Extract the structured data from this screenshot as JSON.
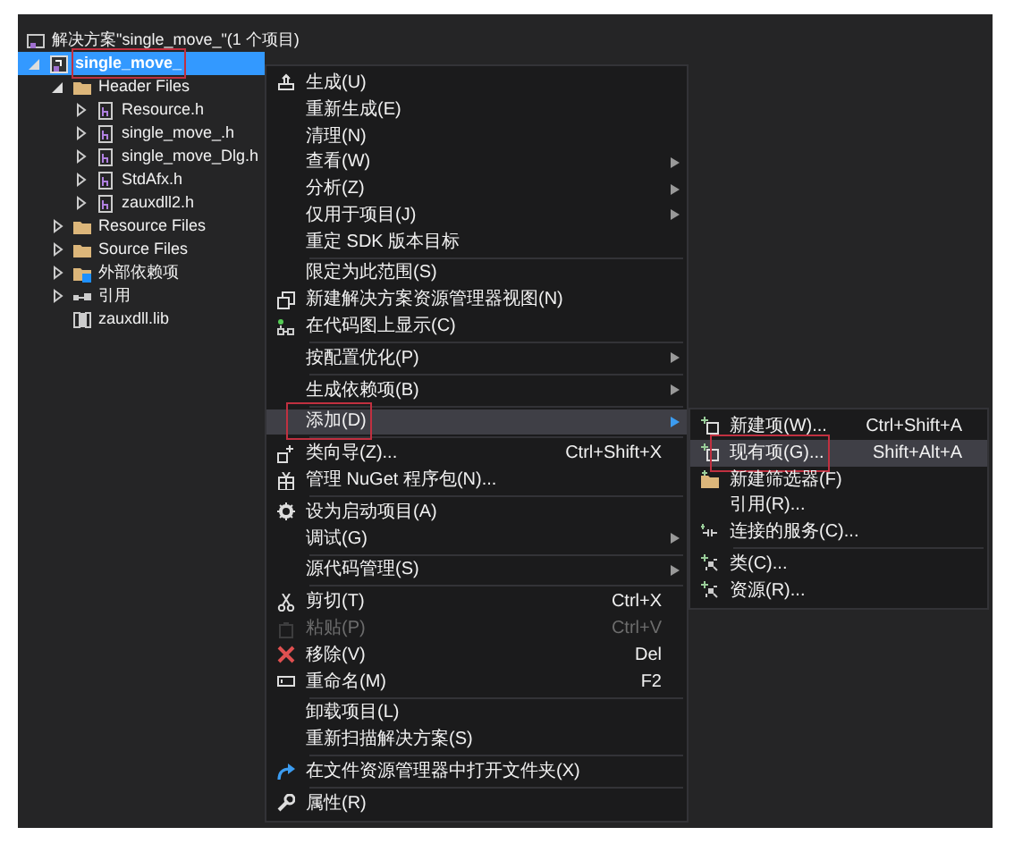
{
  "tree": [
    {
      "label": "解决方案\"single_move_\"(1 个项目)",
      "kind": "solution",
      "selected": false
    },
    {
      "label": "single_move_",
      "kind": "project",
      "selected": true,
      "expanded": true,
      "children": [
        {
          "label": "Header Files",
          "kind": "folder",
          "selected": false,
          "expanded": true,
          "children": [
            {
              "label": "Resource.h",
              "kind": "header",
              "selected": false,
              "expanded": false
            },
            {
              "label": "single_move_.h",
              "kind": "header",
              "selected": false,
              "expanded": false
            },
            {
              "label": "single_move_Dlg.h",
              "kind": "header",
              "selected": false,
              "expanded": false
            },
            {
              "label": "StdAfx.h",
              "kind": "header",
              "selected": false,
              "expanded": false
            },
            {
              "label": "zauxdll2.h",
              "kind": "header",
              "selected": false,
              "expanded": false
            }
          ]
        },
        {
          "label": "Resource Files",
          "kind": "folder",
          "selected": false,
          "expanded": false
        },
        {
          "label": "Source Files",
          "kind": "folder",
          "selected": false,
          "expanded": false
        },
        {
          "label": "外部依赖项",
          "kind": "external",
          "selected": false,
          "expanded": false
        },
        {
          "label": "引用",
          "kind": "references",
          "selected": false,
          "expanded": false
        },
        {
          "label": "zauxdll.lib",
          "kind": "library",
          "selected": false
        }
      ]
    }
  ],
  "context_menu": [
    {
      "kind": "build",
      "label": "生成(U)",
      "selected": false,
      "disabled": false,
      "submenu": false
    },
    {
      "kind": "plain",
      "label": "重新生成(E)",
      "selected": false,
      "disabled": false,
      "submenu": false
    },
    {
      "kind": "plain",
      "label": "清理(N)",
      "selected": false,
      "disabled": false,
      "submenu": false
    },
    {
      "kind": "plain",
      "label": "查看(W)",
      "selected": false,
      "disabled": false,
      "submenu": true
    },
    {
      "kind": "plain",
      "label": "分析(Z)",
      "selected": false,
      "disabled": false,
      "submenu": true
    },
    {
      "kind": "plain",
      "label": "仅用于项目(J)",
      "selected": false,
      "disabled": false,
      "submenu": true
    },
    {
      "kind": "plain",
      "label": "重定 SDK 版本目标",
      "selected": false,
      "disabled": false,
      "submenu": false
    },
    {
      "kind": "separator"
    },
    {
      "kind": "plain",
      "label": "限定为此范围(S)",
      "selected": false,
      "disabled": false,
      "submenu": false
    },
    {
      "kind": "new-view",
      "label": "新建解决方案资源管理器视图(N)",
      "selected": false,
      "disabled": false,
      "submenu": false
    },
    {
      "kind": "code-map",
      "label": "在代码图上显示(C)",
      "selected": false,
      "disabled": false,
      "submenu": false
    },
    {
      "kind": "separator"
    },
    {
      "kind": "plain",
      "label": "按配置优化(P)",
      "selected": false,
      "disabled": false,
      "submenu": true
    },
    {
      "kind": "separator"
    },
    {
      "kind": "plain",
      "label": "生成依赖项(B)",
      "selected": false,
      "disabled": false,
      "submenu": true
    },
    {
      "kind": "separator"
    },
    {
      "kind": "plain",
      "label": "添加(D)",
      "selected": true,
      "disabled": false,
      "submenu": true
    },
    {
      "kind": "separator"
    },
    {
      "kind": "wizard",
      "label": "类向导(Z)...",
      "shortcut": "Ctrl+Shift+X",
      "selected": false,
      "disabled": false,
      "submenu": false
    },
    {
      "kind": "package",
      "label": "管理 NuGet 程序包(N)...",
      "selected": false,
      "disabled": false,
      "submenu": false
    },
    {
      "kind": "separator"
    },
    {
      "kind": "gear",
      "label": "设为启动项目(A)",
      "selected": false,
      "disabled": false,
      "submenu": false
    },
    {
      "kind": "plain",
      "label": "调试(G)",
      "selected": false,
      "disabled": false,
      "submenu": true
    },
    {
      "kind": "separator"
    },
    {
      "kind": "plain",
      "label": "源代码管理(S)",
      "selected": false,
      "disabled": false,
      "submenu": true
    },
    {
      "kind": "separator"
    },
    {
      "kind": "cut",
      "label": "剪切(T)",
      "shortcut": "Ctrl+X",
      "selected": false,
      "disabled": false,
      "submenu": false
    },
    {
      "kind": "paste",
      "label": "粘贴(P)",
      "shortcut": "Ctrl+V",
      "selected": false,
      "disabled": true,
      "submenu": false
    },
    {
      "kind": "remove",
      "label": "移除(V)",
      "shortcut": "Del",
      "selected": false,
      "disabled": false,
      "submenu": false
    },
    {
      "kind": "rename",
      "label": "重命名(M)",
      "shortcut": "F2",
      "selected": false,
      "disabled": false,
      "submenu": false
    },
    {
      "kind": "separator"
    },
    {
      "kind": "plain",
      "label": "卸载项目(L)",
      "selected": false,
      "disabled": false,
      "submenu": false
    },
    {
      "kind": "plain",
      "label": "重新扫描解决方案(S)",
      "selected": false,
      "disabled": false,
      "submenu": false
    },
    {
      "kind": "separator"
    },
    {
      "kind": "open-folder",
      "label": "在文件资源管理器中打开文件夹(X)",
      "selected": false,
      "disabled": false,
      "submenu": false
    },
    {
      "kind": "separator"
    },
    {
      "kind": "wrench",
      "label": "属性(R)",
      "selected": false,
      "disabled": false,
      "submenu": false
    }
  ],
  "add_submenu": [
    {
      "kind": "new-item",
      "label": "新建项(W)...",
      "shortcut": "Ctrl+Shift+A",
      "selected": false
    },
    {
      "kind": "new-item",
      "label": "现有项(G)...",
      "shortcut": "Shift+Alt+A",
      "selected": true
    },
    {
      "kind": "new-folder",
      "label": "新建筛选器(F)",
      "selected": false
    },
    {
      "kind": "plain",
      "label": "引用(R)...",
      "selected": false
    },
    {
      "kind": "service",
      "label": "连接的服务(C)...",
      "selected": false
    },
    {
      "kind": "separator"
    },
    {
      "kind": "class",
      "label": "类(C)...",
      "selected": false
    },
    {
      "kind": "class",
      "label": "资源(R)...",
      "selected": false
    }
  ]
}
